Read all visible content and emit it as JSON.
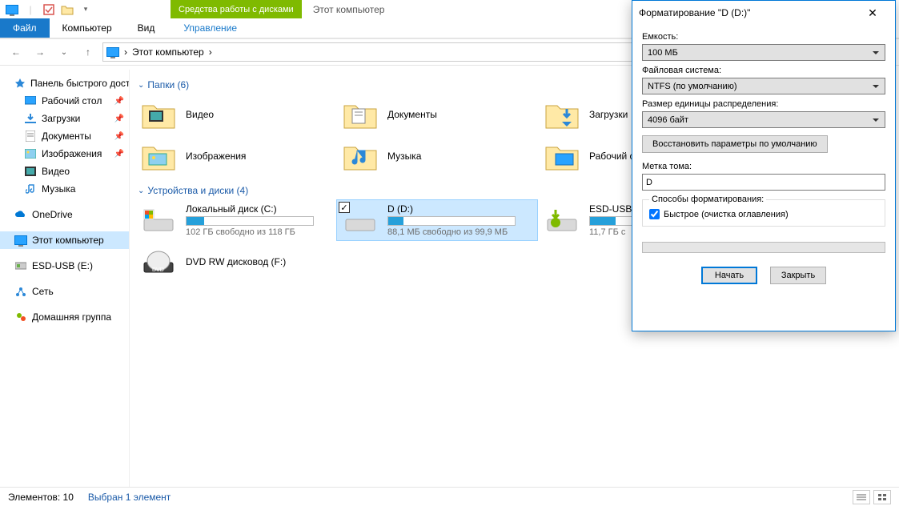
{
  "ribbon": {
    "contextual_header": "Средства работы с дисками",
    "window_title": "Этот компьютер",
    "tabs": {
      "file": "Файл",
      "computer": "Компьютер",
      "view": "Вид",
      "manage": "Управление"
    }
  },
  "address": {
    "location": "Этот компьютер",
    "sep": "›"
  },
  "nav": {
    "quick_access": "Панель быстрого доступа",
    "desktop": "Рабочий стол",
    "downloads": "Загрузки",
    "documents": "Документы",
    "pictures": "Изображения",
    "videos": "Видео",
    "music": "Музыка",
    "onedrive": "OneDrive",
    "this_pc": "Этот компьютер",
    "esd": "ESD-USB (E:)",
    "network": "Сеть",
    "homegroup": "Домашняя группа"
  },
  "groups": {
    "folders": "Папки (6)",
    "drives": "Устройства и диски (4)"
  },
  "folders": {
    "videos": "Видео",
    "documents": "Документы",
    "downloads": "Загрузки",
    "pictures": "Изображения",
    "music": "Музыка",
    "desktop": "Рабочий стол"
  },
  "drives": {
    "c": {
      "name": "Локальный диск (C:)",
      "sub": "102 ГБ свободно из 118 ГБ",
      "fill": 14
    },
    "d": {
      "name": "D (D:)",
      "sub": "88,1 МБ свободно из 99,9 МБ",
      "fill": 12
    },
    "e": {
      "name": "ESD-USB",
      "sub": "11,7 ГБ с",
      "fill": 20
    },
    "f": {
      "name": "DVD RW дисковод (F:)"
    }
  },
  "status": {
    "count": "Элементов: 10",
    "selected": "Выбран 1 элемент"
  },
  "dialog": {
    "title": "Форматирование \"D (D:)\"",
    "capacity_label": "Емкость:",
    "capacity_value": "100 МБ",
    "fs_label": "Файловая система:",
    "fs_value": "NTFS (по умолчанию)",
    "alloc_label": "Размер единицы распределения:",
    "alloc_value": "4096 байт",
    "restore_btn": "Восстановить параметры по умолчанию",
    "label_label": "Метка тома:",
    "label_value": "D",
    "methods_legend": "Способы форматирования:",
    "quick_format": "Быстрое (очистка оглавления)",
    "start": "Начать",
    "close": "Закрыть"
  }
}
